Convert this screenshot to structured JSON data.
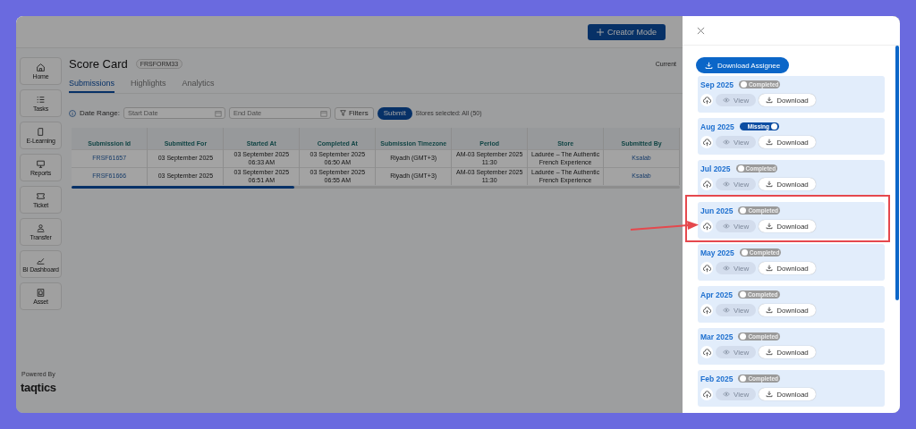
{
  "header": {
    "creator_button": "Creator Mode"
  },
  "sidebar": {
    "items": [
      {
        "label": "Home"
      },
      {
        "label": "Tasks"
      },
      {
        "label": "E-Learning"
      },
      {
        "label": "Reports"
      },
      {
        "label": "Ticket"
      },
      {
        "label": "Transfer"
      },
      {
        "label": "BI Dashboard"
      },
      {
        "label": "Asset"
      }
    ],
    "powered_by": "Powered By",
    "logo": "taqtics"
  },
  "page": {
    "title": "Score Card",
    "code": "FRSFORM33",
    "side_label": "Current"
  },
  "tabs": [
    {
      "label": "Submissions",
      "selected": true
    },
    {
      "label": "Highlights",
      "selected": false
    },
    {
      "label": "Analytics",
      "selected": false
    }
  ],
  "filters": {
    "label": "Date Range:",
    "start": {
      "placeholder": "Start Date"
    },
    "end": {
      "placeholder": "End Date"
    },
    "filters_button": "Filters",
    "submit_button": "Submit",
    "stores": "Stores selected: All (50)"
  },
  "table": {
    "columns": [
      "Submission Id",
      "Submitted For",
      "Started At",
      "Completed At",
      "Submission Timezone",
      "Period",
      "Store",
      "Submitted By"
    ],
    "rows": [
      {
        "cells": [
          "FRSF61657",
          "03 September 2025",
          "03 September 2025 06:33 AM",
          "03 September 2025 06:50 AM",
          "Riyadh (GMT+3)",
          "AM-03 September 2025 11:30",
          "Ladurée – The Authentic French Experience",
          "Ksalab"
        ]
      },
      {
        "cells": [
          "FRSF61666",
          "03 September 2025",
          "03 September 2025 06:51 AM",
          "03 September 2025 06:55 AM",
          "Riyadh (GMT+3)",
          "AM-03 September 2025 11:30",
          "Ladurée – The Authentic French Experience",
          "Ksalab"
        ]
      }
    ]
  },
  "drawer": {
    "download_button": "Download Assignee",
    "periods": [
      {
        "month": "Sep 2025",
        "status": {
          "label": "Completed",
          "on": false
        },
        "view": {
          "label": "View",
          "disabled": true
        },
        "download": "Download"
      },
      {
        "month": "Aug 2025",
        "status": {
          "label": "Missing",
          "on": true
        },
        "view": {
          "label": "View",
          "disabled": true
        },
        "download": "Download"
      },
      {
        "month": "Jul 2025",
        "status": {
          "label": "Completed",
          "on": false
        },
        "view": {
          "label": "View",
          "disabled": true
        },
        "download": "Download"
      },
      {
        "month": "Jun 2025",
        "status": {
          "label": "Completed",
          "on": false
        },
        "view": {
          "label": "View",
          "disabled": true
        },
        "download": "Download"
      },
      {
        "month": "May 2025",
        "status": {
          "label": "Completed",
          "on": false
        },
        "view": {
          "label": "View",
          "disabled": true
        },
        "download": "Download"
      },
      {
        "month": "Apr 2025",
        "status": {
          "label": "Completed",
          "on": false
        },
        "view": {
          "label": "View",
          "disabled": true
        },
        "download": "Download"
      },
      {
        "month": "Mar 2025",
        "status": {
          "label": "Completed",
          "on": false
        },
        "view": {
          "label": "View",
          "disabled": true
        },
        "download": "Download"
      },
      {
        "month": "Feb 2025",
        "status": {
          "label": "Completed",
          "on": false
        },
        "view": {
          "label": "View",
          "disabled": true
        },
        "download": "Download"
      }
    ]
  }
}
